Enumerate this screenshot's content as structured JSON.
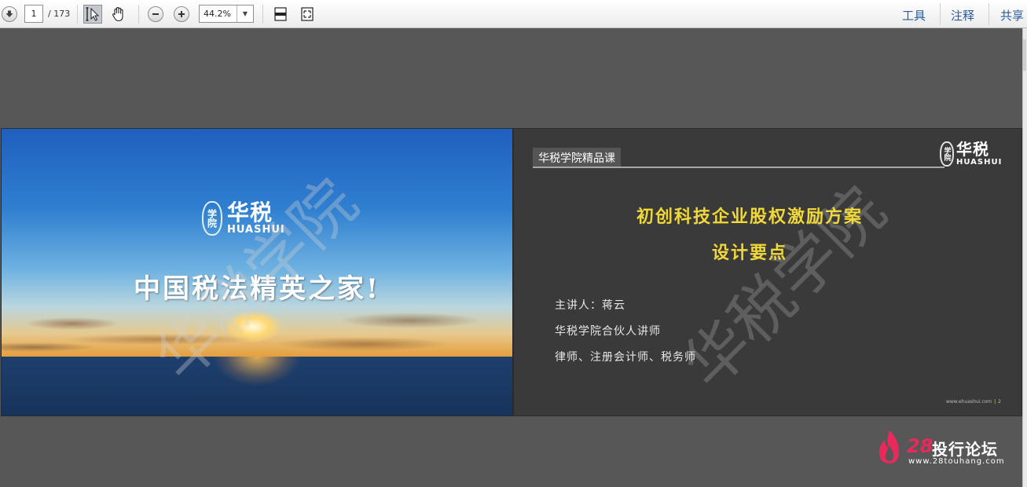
{
  "toolbar": {
    "page_current": "1",
    "page_total": "/ 173",
    "zoom": "44.2%",
    "right_links": [
      "工具",
      "注释",
      "共享"
    ]
  },
  "page1": {
    "logo_cn": "华税",
    "logo_en": "HUASHUI",
    "logo_seal": "学院",
    "slogan": "中国税法精英之家!",
    "watermark": "华税学院"
  },
  "page2": {
    "tag": "华税学院精品课",
    "logo_cn": "华税",
    "logo_en": "HUASHUI",
    "logo_seal": "学院",
    "title_line1": "初创科技企业股权激励方案",
    "title_line2": "设计要点",
    "speaker": "主讲人：蒋云",
    "role": "华税学院合伙人讲师",
    "credentials": "律师、注册会计师、税务师",
    "footer_url": "www.ehuashui.com",
    "footer_page": "2",
    "watermark": "华税学院"
  },
  "forum": {
    "number": "28",
    "name": "投行论坛",
    "url": "www.28touhang.com"
  },
  "colors": {
    "title_yellow": "#f1d83a",
    "link_blue": "#2b5b9c",
    "forum_pink": "#e8295c"
  }
}
